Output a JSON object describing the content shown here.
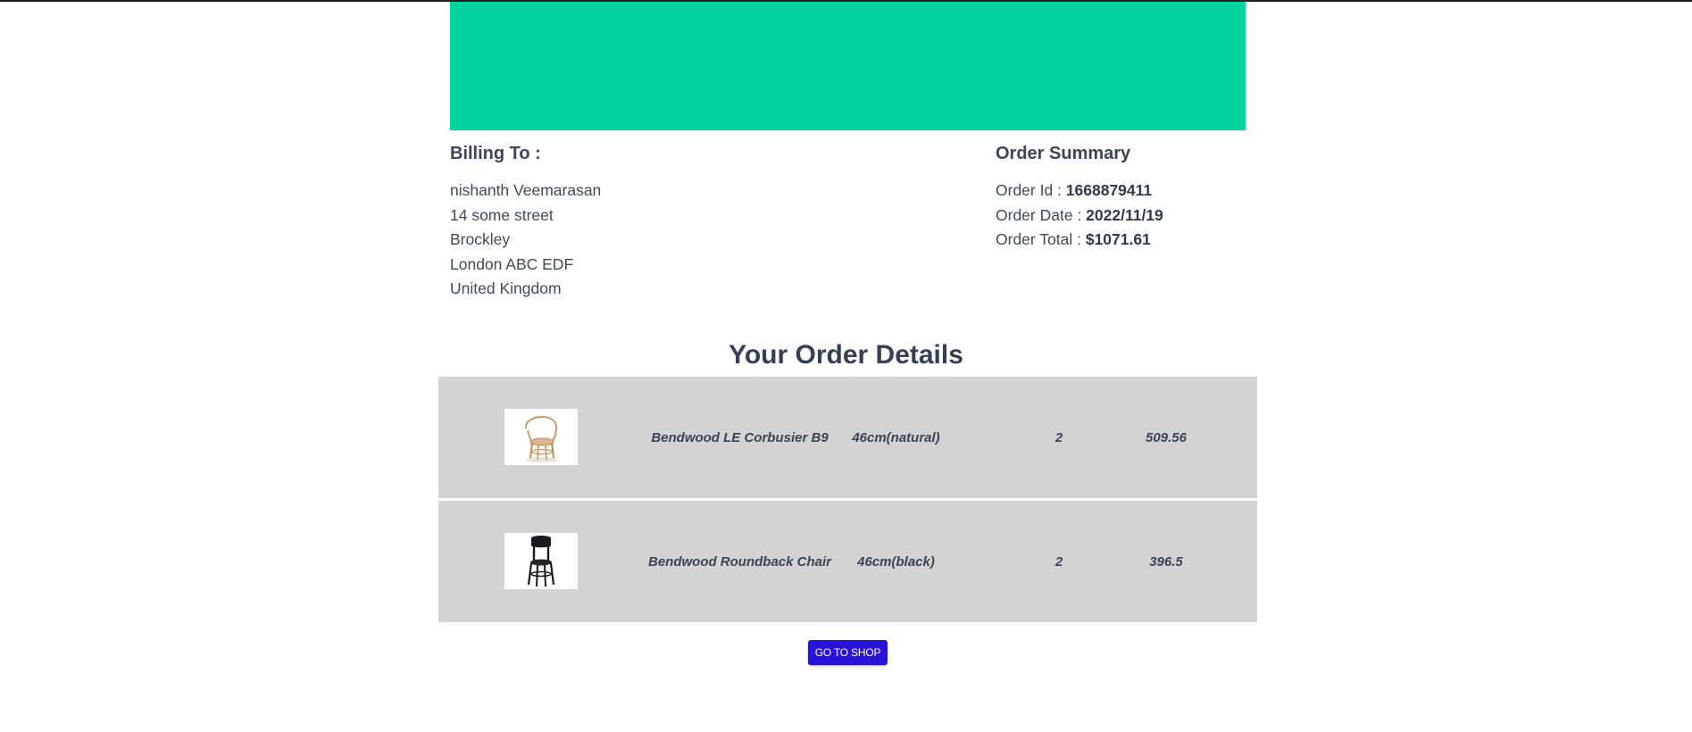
{
  "billing": {
    "title": "Billing To :",
    "name": "nishanth Veemarasan",
    "street": "14 some street",
    "area": "Brockley",
    "city": "London ABC EDF",
    "country": "United Kingdom"
  },
  "summary": {
    "title": "Order Summary",
    "order_id_label": "Order Id : ",
    "order_id": "1668879411",
    "order_date_label": "Order Date : ",
    "order_date": "2022/11/19",
    "order_total_label": "Order Total : ",
    "order_total": "$1071.61"
  },
  "details": {
    "title": "Your Order Details",
    "items": [
      {
        "name": "Bendwood LE Corbusier B9",
        "size": "46cm(natural)",
        "qty": "2",
        "price": "509.56",
        "image": "natural-bentwood-armchair"
      },
      {
        "name": "Bendwood Roundback Chair",
        "size": "46cm(black)",
        "qty": "2",
        "price": "396.5",
        "image": "black-bentwood-chair"
      }
    ]
  },
  "actions": {
    "shop_button": "GO TO SHOP"
  },
  "colors": {
    "banner": "#05d39e",
    "row_bg": "#d3d3d3",
    "button": "#2a13d8"
  }
}
